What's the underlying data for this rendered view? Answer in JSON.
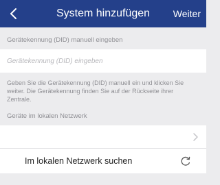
{
  "navbar": {
    "back_icon": "chevron-left-icon",
    "title": "System hinzufügen",
    "action_label": "Weiter",
    "color": "#24408a"
  },
  "did_section": {
    "header": "Gerätekennung (DID) manuell eingeben",
    "input_value": "",
    "input_placeholder": "Gerätekennung (DID) eingeben",
    "help_text": "Geben Sie die Gerätekennung (DID) manuell ein und klicken Sie weiter. Die Gerätekennung finden Sie auf der Rückseite ihrer Zentrale."
  },
  "network_section": {
    "header": "Geräte im lokalen Netzwerk",
    "device_row_text": "",
    "device_row_icon": "chevron-right-icon",
    "search_label": "Im lokalen Netzwerk suchen",
    "search_icon": "refresh-icon"
  }
}
